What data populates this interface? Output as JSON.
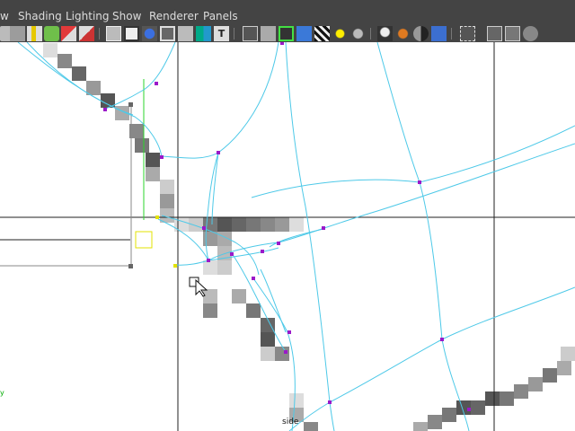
{
  "menu": {
    "items": [
      {
        "label": "w",
        "name": "menu-window-partial"
      },
      {
        "label": "Shading",
        "name": "menu-shading"
      },
      {
        "label": "Lighting",
        "name": "menu-lighting"
      },
      {
        "label": "Show",
        "name": "menu-show"
      },
      {
        "label": "Renderer",
        "name": "menu-renderer"
      },
      {
        "label": "Panels",
        "name": "menu-panels"
      }
    ]
  },
  "toolbar": {
    "icons": [
      {
        "name": "select-camera-icon"
      },
      {
        "name": "camera-attributes-icon"
      },
      {
        "name": "bookmark-icon"
      },
      {
        "name": "image-plane-icon"
      },
      {
        "name": "two-d-pan-zoom-icon"
      },
      {
        "name": "grease-pencil-icon"
      },
      {
        "name": "grid-toggle-icon"
      },
      {
        "name": "film-gate-icon"
      },
      {
        "name": "resolution-gate-icon"
      },
      {
        "name": "gate-mask-icon"
      },
      {
        "name": "field-chart-icon"
      },
      {
        "name": "safe-action-icon"
      },
      {
        "name": "safe-title-icon"
      },
      {
        "name": "wireframe-icon"
      },
      {
        "name": "smooth-shade-icon"
      },
      {
        "name": "wireframe-on-shaded-icon"
      },
      {
        "name": "use-default-material-icon"
      },
      {
        "name": "textured-icon"
      },
      {
        "name": "use-all-lights-icon"
      },
      {
        "name": "shadows-icon"
      },
      {
        "name": "screen-space-ao-icon"
      },
      {
        "name": "motion-blur-icon"
      },
      {
        "name": "anti-aliasing-icon"
      },
      {
        "name": "depth-of-field-icon"
      },
      {
        "name": "isolate-select-icon"
      },
      {
        "name": "xray-icon"
      },
      {
        "name": "xray-joints-icon"
      },
      {
        "name": "xray-active-components-icon"
      }
    ]
  },
  "viewport": {
    "camera_label": "side",
    "axis_label": "y",
    "colors": {
      "background": "#ffffff",
      "wire": "#4ec9e8",
      "vertex": "#9b19c9",
      "grid_line": "#222222",
      "highlight": "#2bd42b",
      "selection": "#e3e300"
    }
  }
}
